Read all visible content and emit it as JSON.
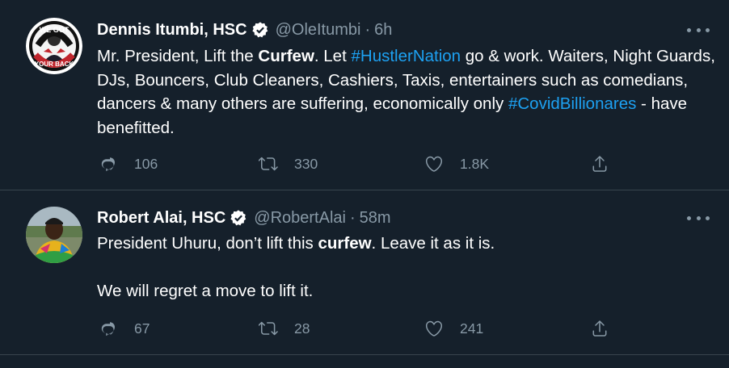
{
  "tweets": [
    {
      "name": "Dennis Itumbi, HSC",
      "handle": "@OleItumbi",
      "separator": "·",
      "time": "6h",
      "avatar_text_top": "WE GOT",
      "avatar_text_bottom": "YOUR BACK",
      "text": {
        "p1": "Mr. President, Lift the ",
        "p2": "Curfew",
        "p3": ". Let ",
        "p4": "#HustlerNation",
        "p5": " go & work. Waiters, Night Guards, DJs, Bouncers, Club Cleaners, Cashiers, Taxis, entertainers such as comedians, dancers & many others are suffering, economically only ",
        "p6": "#CovidBillionares",
        "p7": " - have benefitted."
      },
      "replies": "106",
      "retweets": "330",
      "likes": "1.8K"
    },
    {
      "name": "Robert Alai, HSC",
      "handle": "@RobertAlai",
      "separator": "·",
      "time": "58m",
      "text": {
        "p1": "President Uhuru, don’t lift this ",
        "p2": "curfew",
        "p3": ". Leave it as it is.",
        "p4": "We will regret a move to lift it."
      },
      "replies": "67",
      "retweets": "28",
      "likes": "241"
    }
  ],
  "icons": {
    "verified": "verified-badge-icon",
    "more": "more-options-icon",
    "reply": "reply-icon",
    "retweet": "retweet-icon",
    "like": "like-heart-icon",
    "share": "share-icon"
  },
  "colors": {
    "background": "#15202b",
    "text": "#ffffff",
    "secondary": "#8899a6",
    "link": "#1da1f2",
    "divider": "#38444d"
  }
}
